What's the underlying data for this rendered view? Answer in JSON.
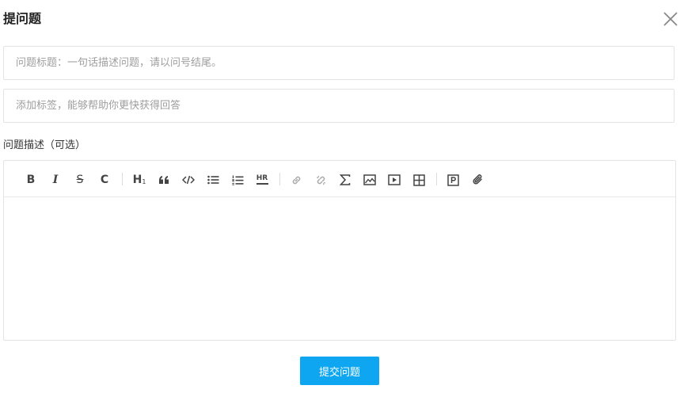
{
  "dialog": {
    "title": "提问题",
    "close_icon": "close-icon"
  },
  "form": {
    "title_placeholder": "问题标题：一句话描述问题，请以问号结尾。",
    "title_value": "",
    "tags_placeholder": "添加标签，能够帮助你更快获得回答",
    "tags_value": "",
    "description_label": "问题描述（可选）",
    "description_value": "",
    "submit_label": "提交问题"
  },
  "toolbar": {
    "bold_label": "B",
    "italic_label": "I",
    "strike_label": "S",
    "code_label": "C",
    "heading_label": "H",
    "heading_sub": "1",
    "hr_label": "HR",
    "buttons": [
      {
        "name": "bold",
        "icon": "bold-icon"
      },
      {
        "name": "italic",
        "icon": "italic-icon"
      },
      {
        "name": "strikethrough",
        "icon": "strikethrough-icon"
      },
      {
        "name": "code",
        "icon": "code-icon"
      },
      {
        "name": "heading",
        "icon": "heading-icon"
      },
      {
        "name": "quote",
        "icon": "quote-icon"
      },
      {
        "name": "code-block",
        "icon": "code-block-icon"
      },
      {
        "name": "unordered-list",
        "icon": "unordered-list-icon"
      },
      {
        "name": "ordered-list",
        "icon": "ordered-list-icon"
      },
      {
        "name": "horizontal-rule",
        "icon": "horizontal-rule-icon"
      },
      {
        "name": "link",
        "icon": "link-icon"
      },
      {
        "name": "unlink",
        "icon": "unlink-icon"
      },
      {
        "name": "formula",
        "icon": "sigma-icon"
      },
      {
        "name": "image",
        "icon": "image-icon"
      },
      {
        "name": "video",
        "icon": "video-icon"
      },
      {
        "name": "table",
        "icon": "table-icon"
      },
      {
        "name": "preview",
        "icon": "preview-icon"
      },
      {
        "name": "attachment",
        "icon": "paperclip-icon"
      }
    ]
  },
  "colors": {
    "primary": "#0ea6f0",
    "border": "#e3e3e3",
    "placeholder": "#9e9e9e"
  }
}
